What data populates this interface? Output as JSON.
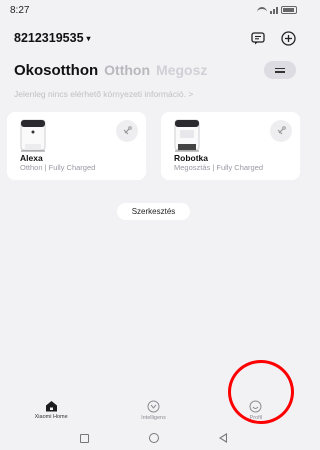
{
  "status_bar": {
    "time": "8:27",
    "icons": [
      "wifi-icon",
      "signal-icon",
      "battery-icon"
    ]
  },
  "header": {
    "account_id": "8212319535",
    "caret": "▾",
    "actions": [
      "message-icon",
      "add-icon"
    ]
  },
  "tabs": [
    {
      "label": "Okosotthon",
      "active": true
    },
    {
      "label": "Otthon",
      "active": false
    },
    {
      "label": "Megosz",
      "active": false
    }
  ],
  "env_info": "Jelenleg nincs elérhető környezeti információ. >",
  "devices": [
    {
      "name": "Alexa",
      "subtitle": "Otthon | Fully Charged",
      "icon": "robot-vacuum-icon"
    },
    {
      "name": "Robotka",
      "subtitle": "Megosztás | Fully Charged",
      "icon": "robot-vacuum-icon"
    }
  ],
  "edit_label": "Szerkesztés",
  "bottom_nav": [
    {
      "label": "Xiaomi Home",
      "icon": "home-icon",
      "active": true
    },
    {
      "label": "Intelligens",
      "icon": "smart-icon",
      "active": false
    },
    {
      "label": "Profil",
      "icon": "profile-icon",
      "active": false
    }
  ],
  "highlight_color": "#ff0000",
  "system_nav": [
    "recent-apps-icon",
    "home-circle-icon",
    "back-icon"
  ]
}
